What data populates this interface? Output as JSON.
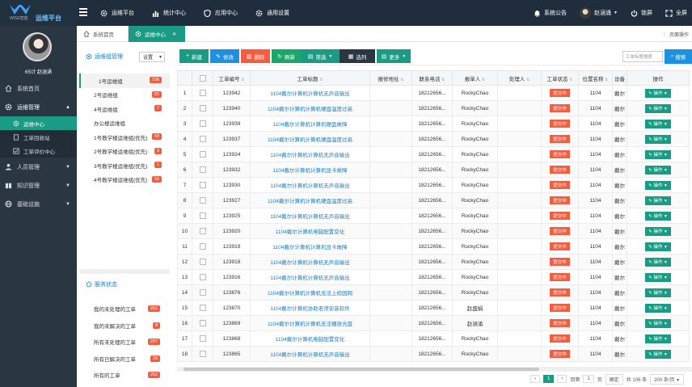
{
  "brand": {
    "sub": "WISE智能",
    "name": "运维平台"
  },
  "topnav": [
    {
      "label": "运维平台",
      "icon": "gear-icon"
    },
    {
      "label": "统计中心",
      "icon": "bar-chart-icon"
    },
    {
      "label": "应用中心",
      "icon": "shield-icon"
    },
    {
      "label": "通用设置",
      "icon": "gear-icon"
    }
  ],
  "topright": {
    "notice": "系统公告",
    "user": "赵涵涌",
    "logout": "锁屏",
    "fullscreen": "全屏"
  },
  "profile": {
    "name": "6S计 赵涵涌"
  },
  "sidebar": {
    "items": [
      {
        "label": "系统首页"
      },
      {
        "label": "运维管理"
      },
      {
        "label": "人员管理"
      },
      {
        "label": "知识管理"
      },
      {
        "label": "基础设施"
      }
    ],
    "subitems": [
      {
        "label": "运维中心"
      },
      {
        "label": "工单回收站"
      },
      {
        "label": "工单评价中心"
      }
    ]
  },
  "tabs": {
    "home": "系统首页",
    "current": "运维中心",
    "page_op": "页面操作"
  },
  "left_panel": {
    "title": "运维组管理",
    "select": "设置",
    "groups": [
      {
        "label": "1号运维组",
        "count": "106"
      },
      {
        "label": "2号运维组",
        "count": "82"
      },
      {
        "label": "4号运维组",
        "count": "7"
      },
      {
        "label": "办公楼运维组",
        "count": ""
      },
      {
        "label": "1号教学楼运维组(优先)",
        "count": "43"
      },
      {
        "label": "2号教学楼运维组(优先)",
        "count": "3"
      },
      {
        "label": "3号教学楼运维组(优先)",
        "count": "1"
      },
      {
        "label": "4号教学楼运维组(优先)",
        "count": "16"
      }
    ],
    "service_title": "服务状态",
    "service": [
      {
        "label": "我的未处理的工单",
        "count": "201"
      },
      {
        "label": "我的未解决的工单",
        "count": "8"
      },
      {
        "label": "所有未处理的工单",
        "count": "207"
      },
      {
        "label": "所有已解决的工单",
        "count": "29"
      },
      {
        "label": "所有的工单",
        "count": "252"
      }
    ]
  },
  "toolbar": {
    "add": "新建",
    "edit": "修改",
    "delete": "删除",
    "refresh": "刷新",
    "filter": "筛选",
    "columns": "选列",
    "more": "更多",
    "search_placeholder": "工单标题搜索",
    "search": "搜索"
  },
  "table": {
    "headers": [
      "",
      "",
      "工单编号",
      "工单标题",
      "报修地址",
      "联系电话",
      "报单人",
      "处理人",
      "工单状态",
      "位置名称",
      "设备",
      "操作"
    ],
    "rows": [
      {
        "no": "1",
        "id": "123942",
        "title": "1104戴尔计算机计算机无声音输出",
        "phone": "18212656...",
        "reporter": "RockyChao",
        "handler": "",
        "status": "提交中",
        "loc": "1104",
        "dev": "戴尔",
        "op": "操作"
      },
      {
        "no": "2",
        "id": "123940",
        "title": "1104戴尔计算机计算机硬盘温度过高",
        "phone": "18212656...",
        "reporter": "RockyChao",
        "handler": "",
        "status": "提交中",
        "loc": "1104",
        "dev": "戴尔",
        "op": "操作"
      },
      {
        "no": "3",
        "id": "123939",
        "title": "1104戴尔计算机计算机硬盘故障",
        "phone": "18212656...",
        "reporter": "RockyChao",
        "handler": "",
        "status": "提交中",
        "loc": "1104",
        "dev": "戴尔",
        "op": "操作"
      },
      {
        "no": "4",
        "id": "123937",
        "title": "1104戴尔计算机计算机硬盘温度过高",
        "phone": "18212656...",
        "reporter": "RockyChao",
        "handler": "",
        "status": "提交中",
        "loc": "1104",
        "dev": "戴尔",
        "op": "操作"
      },
      {
        "no": "5",
        "id": "123934",
        "title": "1104戴尔计算机计算机无声音输出",
        "phone": "18212656...",
        "reporter": "RockyChao",
        "handler": "",
        "status": "提交中",
        "loc": "1104",
        "dev": "戴尔",
        "op": "操作"
      },
      {
        "no": "6",
        "id": "123932",
        "title": "1104戴尔计算机计算机显卡故障",
        "phone": "18212656...",
        "reporter": "RockyChao",
        "handler": "",
        "status": "提交中",
        "loc": "1104",
        "dev": "戴尔",
        "op": "操作"
      },
      {
        "no": "7",
        "id": "123930",
        "title": "1104戴尔计算机计算机无声音输出",
        "phone": "18212656...",
        "reporter": "RockyChao",
        "handler": "",
        "status": "提交中",
        "loc": "1104",
        "dev": "戴尔",
        "op": "操作"
      },
      {
        "no": "8",
        "id": "123927",
        "title": "1104戴尔计算机计算机硬盘温度过高",
        "phone": "18212656...",
        "reporter": "RockyChao",
        "handler": "",
        "status": "提交中",
        "loc": "1104",
        "dev": "戴尔",
        "op": "操作"
      },
      {
        "no": "9",
        "id": "123925",
        "title": "1104戴尔计算机计算机无声音输出",
        "phone": "18212656...",
        "reporter": "RockyChao",
        "handler": "",
        "status": "提交中",
        "loc": "1104",
        "dev": "戴尔",
        "op": "操作"
      },
      {
        "no": "10",
        "id": "123920",
        "title": "1104戴尔计算机电脑配置变化",
        "phone": "18212656...",
        "reporter": "RockyChao",
        "handler": "",
        "status": "提交中",
        "loc": "1104",
        "dev": "戴尔",
        "op": "操作"
      },
      {
        "no": "11",
        "id": "123919",
        "title": "1104戴尔计算机计算机显卡故障",
        "phone": "18212656...",
        "reporter": "RockyChao",
        "handler": "",
        "status": "提交中",
        "loc": "1104",
        "dev": "戴尔",
        "op": "操作"
      },
      {
        "no": "12",
        "id": "123918",
        "title": "1104戴尔计算机计算机无声音输出",
        "phone": "18212656...",
        "reporter": "RockyChao",
        "handler": "",
        "status": "提交中",
        "loc": "1104",
        "dev": "戴尔",
        "op": "操作"
      },
      {
        "no": "13",
        "id": "123916",
        "title": "1104戴尔计算机计算机无声音输出",
        "phone": "18212656...",
        "reporter": "RockyChao",
        "handler": "",
        "status": "提交中",
        "loc": "1104",
        "dev": "戴尔",
        "op": "操作"
      },
      {
        "no": "14",
        "id": "123876",
        "title": "1104戴尔计算机计算机无法上校园网",
        "phone": "18212656...",
        "reporter": "RockyChao",
        "handler": "",
        "status": "提交中",
        "loc": "1104",
        "dev": "戴尔",
        "op": "操作"
      },
      {
        "no": "15",
        "id": "123870",
        "title": "1104戴尔计算机协助老师安装软件",
        "phone": "18212656...",
        "reporter": "赵盛娟",
        "handler": "",
        "status": "提交中",
        "loc": "1104",
        "dev": "戴尔",
        "op": "操作"
      },
      {
        "no": "16",
        "id": "123869",
        "title": "1104戴尔计算机计算机无法播放光盘",
        "phone": "18212656...",
        "reporter": "赵涵涌",
        "handler": "",
        "status": "提交中",
        "loc": "1104",
        "dev": "戴尔",
        "op": "操作"
      },
      {
        "no": "17",
        "id": "123868",
        "title": "1104戴尔计算机电脑配置变化",
        "phone": "18212656...",
        "reporter": "RockyChao",
        "handler": "",
        "status": "提交中",
        "loc": "1104",
        "dev": "戴尔",
        "op": "操作"
      },
      {
        "no": "18",
        "id": "123865",
        "title": "1104戴尔计算机计算机无声音输出",
        "phone": "18212656...",
        "reporter": "RockyChao",
        "handler": "",
        "status": "提交中",
        "loc": "1104",
        "dev": "戴尔",
        "op": "操作"
      }
    ]
  },
  "pager": {
    "current": "1",
    "goto": "到第",
    "page_val": "1",
    "page_unit": "页",
    "confirm": "确定",
    "total": "共 106 条",
    "per_page": "200 条/页"
  },
  "colors": {
    "topbar": "#1f2d3d",
    "sidebar": "#2b3643",
    "accent": "#1a9c84",
    "danger": "#f45d3f",
    "link": "#1a7fc1"
  }
}
